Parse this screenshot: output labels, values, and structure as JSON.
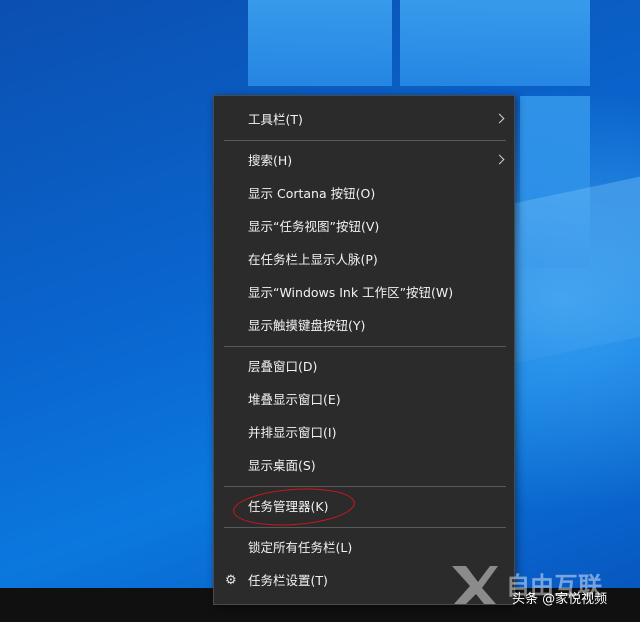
{
  "context_menu": {
    "items": [
      {
        "label": "工具栏(T)",
        "submenu": true
      },
      {
        "label": "搜索(H)",
        "submenu": true
      },
      {
        "label": "显示 Cortana 按钮(O)"
      },
      {
        "label": "显示“任务视图”按钮(V)"
      },
      {
        "label": "在任务栏上显示人脉(P)"
      },
      {
        "label": "显示“Windows Ink 工作区”按钮(W)"
      },
      {
        "label": "显示触摸键盘按钮(Y)"
      },
      {
        "label": "层叠窗口(D)"
      },
      {
        "label": "堆叠显示窗口(E)"
      },
      {
        "label": "并排显示窗口(I)"
      },
      {
        "label": "显示桌面(S)"
      },
      {
        "label": "任务管理器(K)",
        "highlighted": true
      },
      {
        "label": "锁定所有任务栏(L)"
      },
      {
        "label": "任务栏设置(T)",
        "icon": "gear-icon"
      }
    ]
  },
  "watermark": {
    "logo_text": "自由互联",
    "caption": "头条 @家悦视频"
  },
  "colors": {
    "menu_bg": "#2b2b2b",
    "menu_text": "#f2f2f2",
    "separator": "#5a5a5a",
    "annotation_circle": "#d0161c",
    "taskbar": "#101010"
  }
}
